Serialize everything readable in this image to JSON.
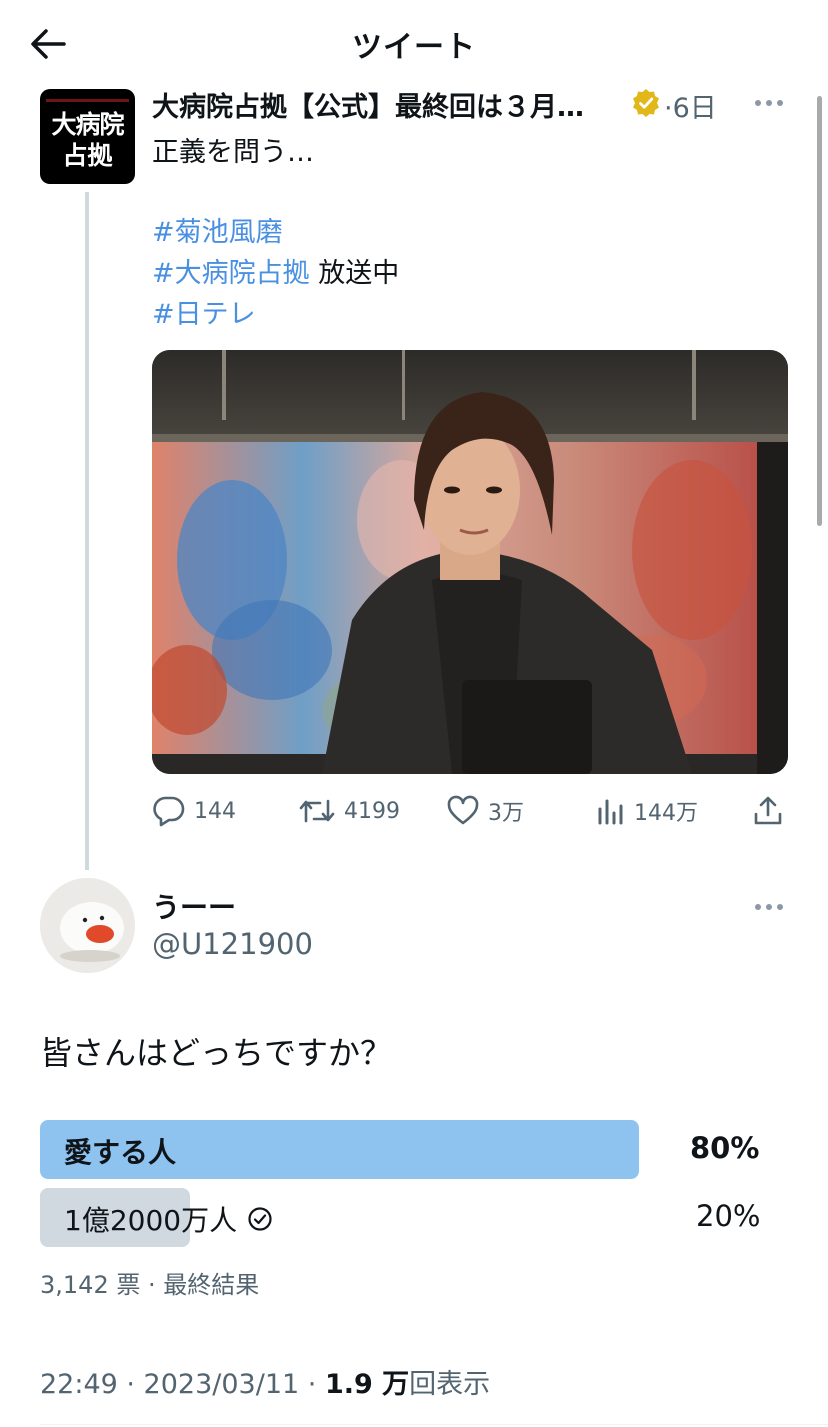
{
  "header": {
    "title": "ツイート"
  },
  "tweet": {
    "author_name": "大病院占拠【公式】最終回は３月…",
    "time": "·6日",
    "text": "正義を問う…",
    "hashtags": [
      {
        "tag": "#菊池風磨",
        "suffix": ""
      },
      {
        "tag": "#大病院占拠",
        "suffix": " 放送中"
      },
      {
        "tag": "#日テレ",
        "suffix": ""
      }
    ],
    "avatar_text_line1": "大病院",
    "avatar_text_line2": "占拠",
    "stats": {
      "replies": "144",
      "retweets": "4199",
      "likes": "3万",
      "views": "144万"
    }
  },
  "reply": {
    "name": "うーー",
    "handle": "@U121900",
    "text": "皆さんはどっちですか？",
    "poll": {
      "options": [
        {
          "label": "愛する人",
          "percent": "80%",
          "fraction": 0.8
        },
        {
          "label": "1億2000万人",
          "percent": "20%",
          "fraction": 0.2
        }
      ],
      "meta": "3,142 票 · 最終結果"
    },
    "footer_time": "22:49 · 2023/03/11 · ",
    "footer_views": "1.9 万",
    "footer_suffix": "回表示"
  },
  "colors": {
    "link": "#4a90e2",
    "poll_winner": "#8ec3f0",
    "poll_other": "#d0d9df",
    "muted": "#536471"
  }
}
